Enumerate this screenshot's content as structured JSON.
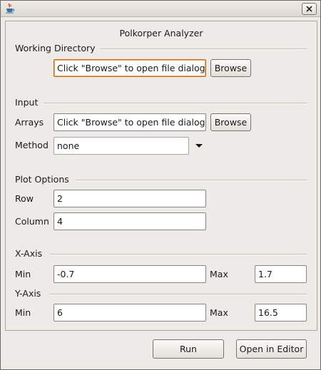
{
  "window": {
    "app_icon": "java-cup-icon",
    "close_icon": "close-x-icon"
  },
  "header": {
    "title": "Polkorper Analyzer"
  },
  "working_directory": {
    "section_label": "Working Directory",
    "field_value": "Click \"Browse\" to open file dialog",
    "browse_label": "Browse"
  },
  "input": {
    "section_label": "Input",
    "arrays_label": "Arrays",
    "arrays_value": "Click \"Browse\" to open file dialog",
    "browse_label": "Browse",
    "method_label": "Method",
    "method_value": "none"
  },
  "plot_options": {
    "section_label": "Plot Options",
    "row_label": "Row",
    "row_value": "2",
    "column_label": "Column",
    "column_value": "4"
  },
  "x_axis": {
    "section_label": "X-Axis",
    "min_label": "Min",
    "min_value": "-0.7",
    "max_label": "Max",
    "max_value": "1.7"
  },
  "y_axis": {
    "section_label": "Y-Axis",
    "min_label": "Min",
    "min_value": "6",
    "max_label": "Max",
    "max_value": "16.5"
  },
  "footer": {
    "run_label": "Run",
    "open_editor_label": "Open in Editor"
  },
  "colors": {
    "window_bg": "#edebe8",
    "focus_border": "#c96f1e"
  }
}
